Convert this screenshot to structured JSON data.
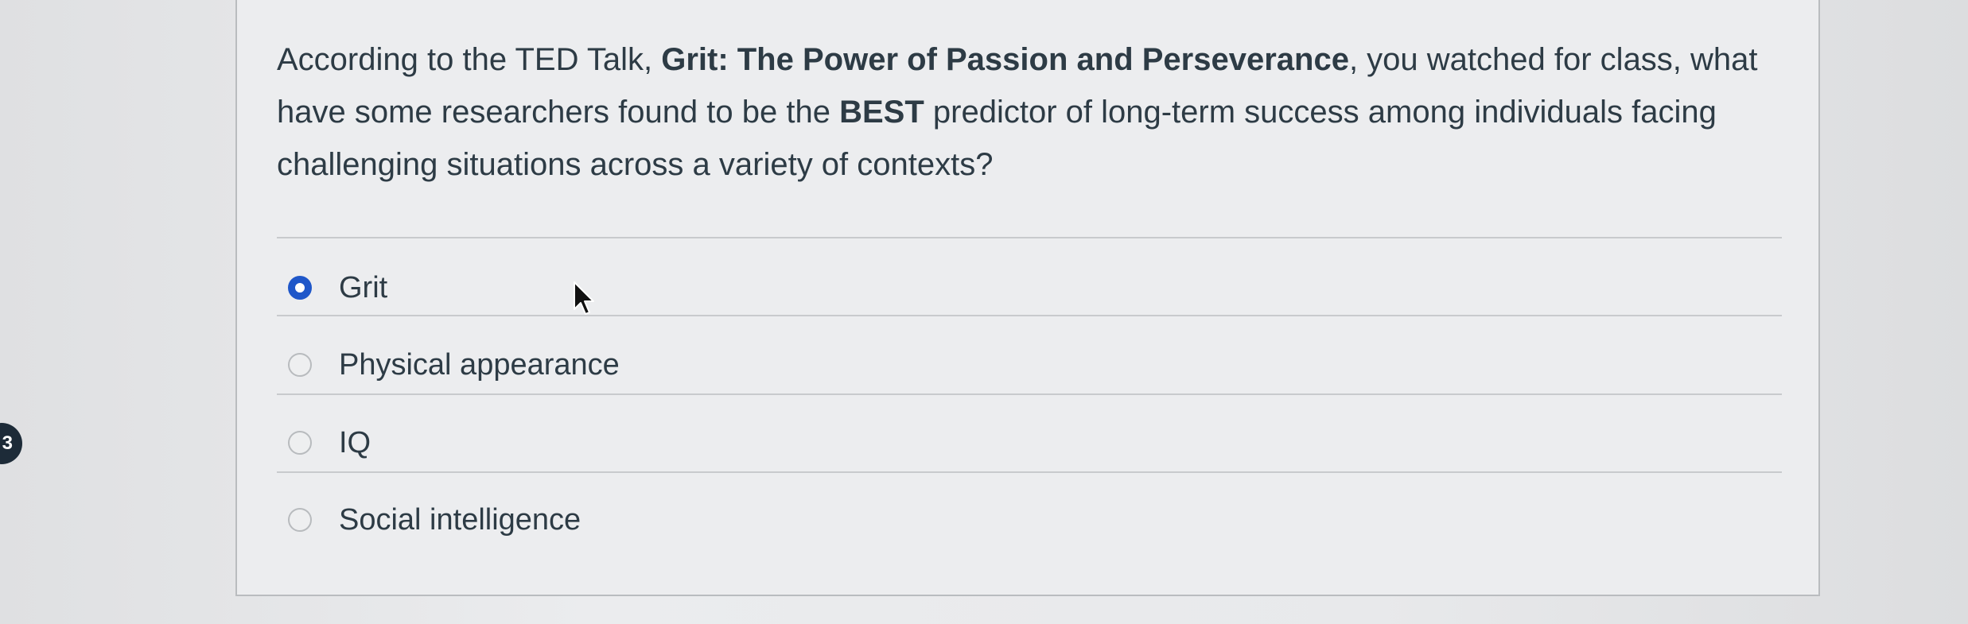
{
  "question": {
    "text_part1": "According to the TED Talk, ",
    "talk_title": "Grit: The Power of Passion and Perseverance",
    "text_part2": ", you watched for class, what have some researchers found to be the ",
    "emphasis": "BEST",
    "text_part3": " predictor of long-term success among individuals facing challenging situations across a variety of contexts?"
  },
  "answers": [
    {
      "label": "Grit",
      "selected": true
    },
    {
      "label": "Physical appearance",
      "selected": false
    },
    {
      "label": "IQ",
      "selected": false
    },
    {
      "label": "Social intelligence",
      "selected": false
    }
  ],
  "sidebar": {
    "question_number_badge": "3"
  },
  "colors": {
    "accent": "#1f57c9",
    "text": "#2d3b45",
    "background": "#ecedef"
  }
}
